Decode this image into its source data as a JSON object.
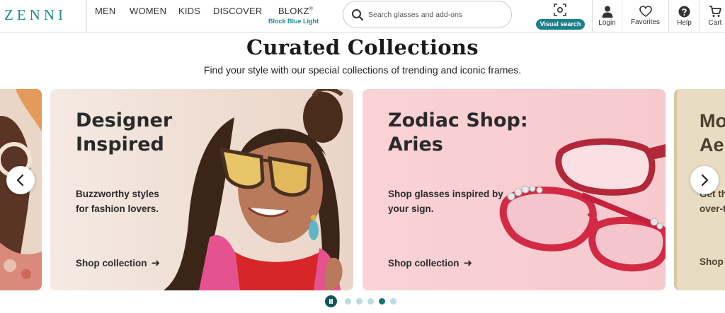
{
  "brand": {
    "logo": "ZENNI",
    "accent_color": "#1d8a97"
  },
  "nav": {
    "items": [
      "MEN",
      "WOMEN",
      "KIDS",
      "DISCOVER"
    ],
    "blokz": {
      "label": "BLOKZ",
      "trademark": "®",
      "sublabel": "Block Blue Light"
    }
  },
  "search": {
    "placeholder": "Search glasses and add-ons",
    "icon": "search-icon"
  },
  "visual_search": {
    "label": "Visual search",
    "icon": "camera-scan-icon"
  },
  "utility": [
    {
      "label": "Login",
      "icon": "user-icon"
    },
    {
      "label": "Favorites",
      "icon": "heart-icon"
    },
    {
      "label": "Help",
      "icon": "help-icon"
    },
    {
      "label": "Cart",
      "icon": "cart-icon"
    }
  ],
  "hero": {
    "title": "Curated Collections",
    "subtitle": "Find your style with our special collections of trending and iconic frames."
  },
  "cards": [
    {
      "title_line1": "Designer",
      "title_line2": "Inspired",
      "desc_line1": "Buzzworthy styles",
      "desc_line2": "for fashion lovers.",
      "link": "Shop collection"
    },
    {
      "title_line1": "Zodiac Shop:",
      "title_line2": "Aries",
      "desc_line1": "Shop glasses inspired by",
      "desc_line2": "your sign.",
      "link": "Shop collection"
    },
    {
      "title_line1": "Mo",
      "title_line2": "Ae",
      "desc_line1": "Get th",
      "desc_line2": "over-t",
      "link": "Shop"
    }
  ],
  "carousel": {
    "dot_count": 5,
    "active_dot": 4,
    "paused_icon": "pause-icon"
  }
}
